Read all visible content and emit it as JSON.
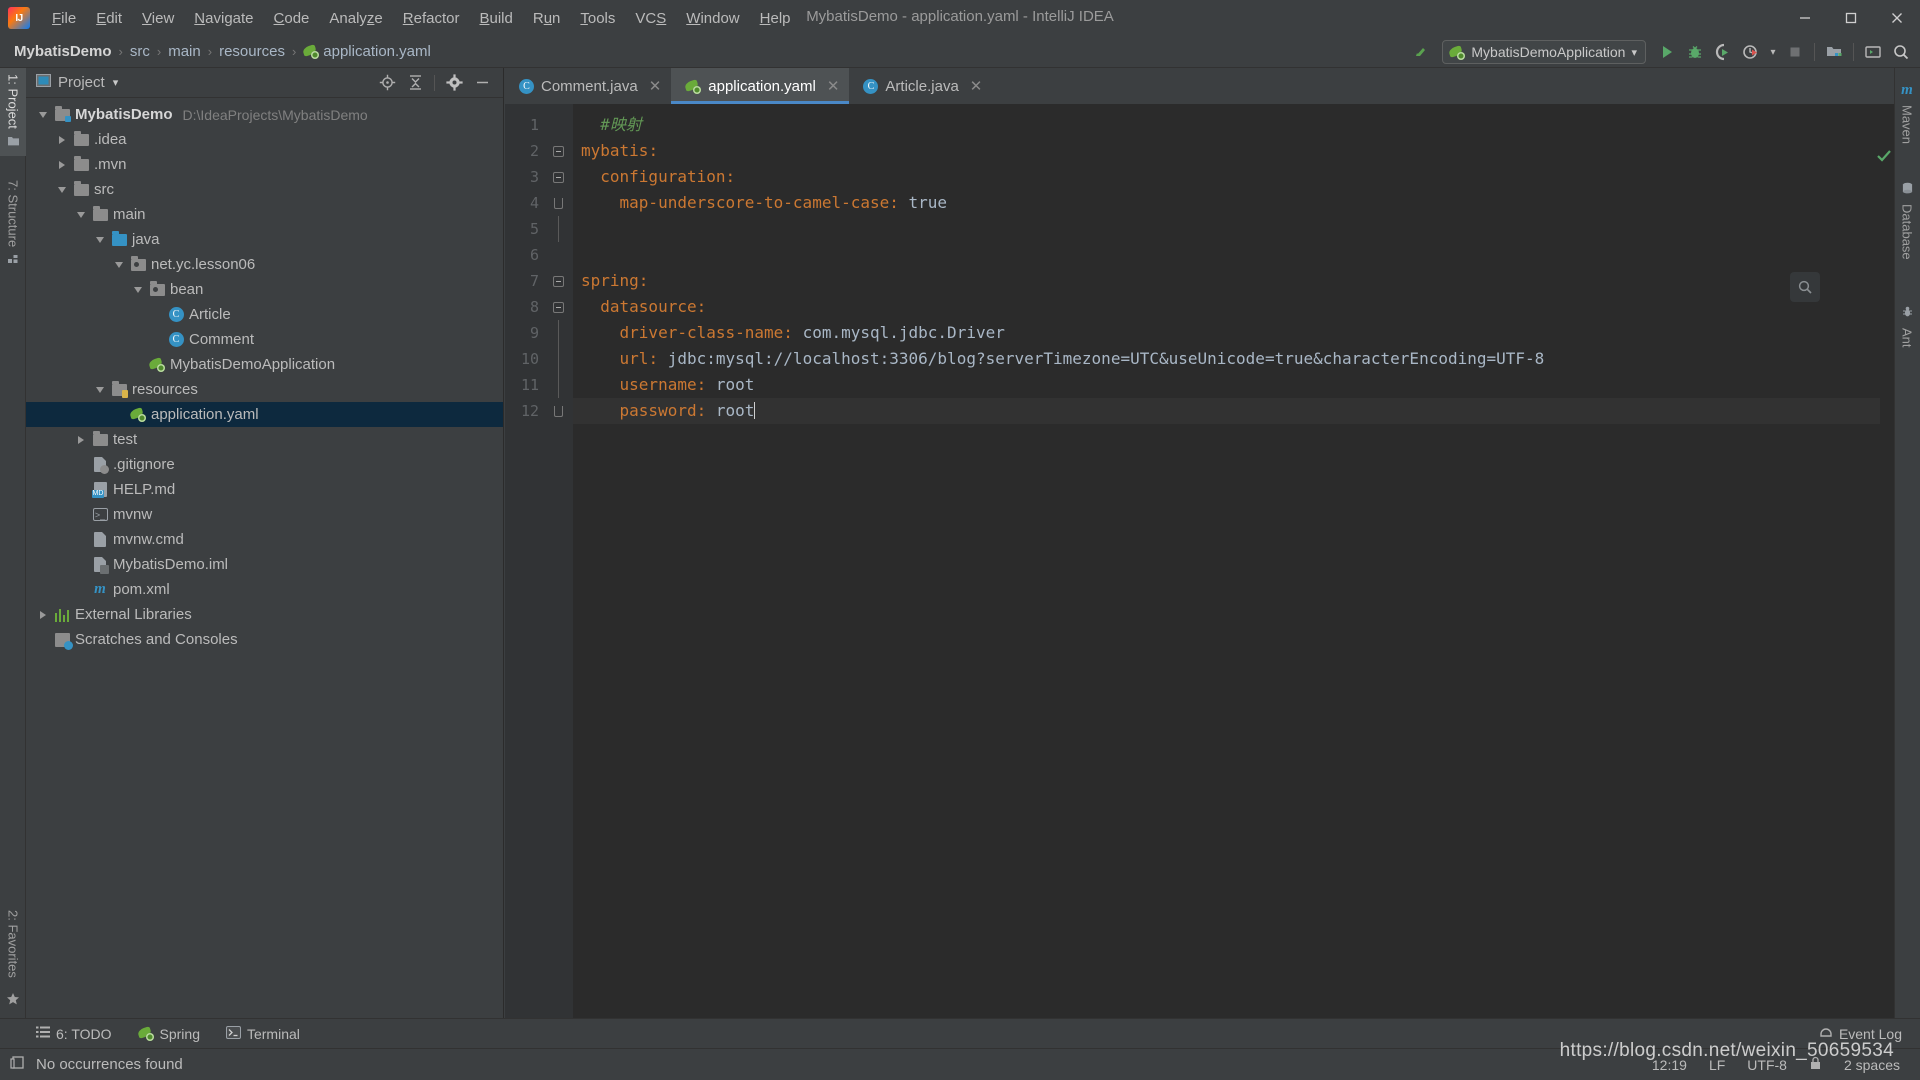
{
  "window": {
    "title": "MybatisDemo - application.yaml - IntelliJ IDEA",
    "minimize": "—",
    "maximize": "❐",
    "close": "✕"
  },
  "menu": {
    "items": [
      {
        "label": "File",
        "mnemonic": "F"
      },
      {
        "label": "Edit",
        "mnemonic": "E"
      },
      {
        "label": "View",
        "mnemonic": "V"
      },
      {
        "label": "Navigate",
        "mnemonic": "N"
      },
      {
        "label": "Code",
        "mnemonic": "C"
      },
      {
        "label": "Analyze",
        "mnemonic": "z"
      },
      {
        "label": "Refactor",
        "mnemonic": "R"
      },
      {
        "label": "Build",
        "mnemonic": "B"
      },
      {
        "label": "Run",
        "mnemonic": "u"
      },
      {
        "label": "Tools",
        "mnemonic": "T"
      },
      {
        "label": "VCS",
        "mnemonic": "S"
      },
      {
        "label": "Window",
        "mnemonic": "W"
      },
      {
        "label": "Help",
        "mnemonic": "H"
      }
    ]
  },
  "breadcrumb": {
    "items": [
      "MybatisDemo",
      "src",
      "main",
      "resources",
      "application.yaml"
    ],
    "separator": "›"
  },
  "toolbar": {
    "run_config": "MybatisDemoApplication",
    "run_config_dropdown": "▾",
    "buttons": [
      {
        "name": "run-button",
        "label": "Run"
      },
      {
        "name": "debug-button",
        "label": "Debug"
      },
      {
        "name": "run-coverage-button",
        "label": "Run with Coverage"
      },
      {
        "name": "profile-button",
        "label": "Profile"
      },
      {
        "name": "stop-button",
        "label": "Stop"
      },
      {
        "name": "project-structure-button",
        "label": "Project Structure"
      },
      {
        "name": "terminal-button",
        "label": "Terminal"
      },
      {
        "name": "search-everywhere-button",
        "label": "Search Everywhere"
      }
    ]
  },
  "left_stripe": {
    "items": [
      {
        "label": "1: Project",
        "mnemonic": "1",
        "active": true
      },
      {
        "label": "7: Structure",
        "mnemonic": "7",
        "active": false
      },
      {
        "label": "2: Favorites",
        "mnemonic": "2",
        "active": false
      }
    ]
  },
  "right_stripe": {
    "items": [
      {
        "label": "Maven",
        "icon": "m"
      },
      {
        "label": "Database",
        "icon": "db"
      },
      {
        "label": "Ant",
        "icon": "ant"
      }
    ]
  },
  "project_panel": {
    "title": "Project",
    "dropdown_caret": "▾",
    "actions": [
      {
        "name": "locate-file-icon",
        "label": "Select Opened File"
      },
      {
        "name": "collapse-all-icon",
        "label": "Collapse All"
      },
      {
        "name": "gear-icon",
        "label": "Settings"
      },
      {
        "name": "hide-icon",
        "label": "Hide"
      }
    ],
    "tree": [
      {
        "indent": 0,
        "arrow": "down",
        "icon": "folder-src",
        "label": "MybatisDemo",
        "bold": true,
        "sub": "D:\\IdeaProjects\\MybatisDemo",
        "selected": false
      },
      {
        "indent": 1,
        "arrow": "right",
        "icon": "folder",
        "label": ".idea",
        "bold": false,
        "sub": "",
        "selected": false
      },
      {
        "indent": 1,
        "arrow": "right",
        "icon": "folder",
        "label": ".mvn",
        "bold": false,
        "sub": "",
        "selected": false
      },
      {
        "indent": 1,
        "arrow": "down",
        "icon": "folder",
        "label": "src",
        "bold": false,
        "sub": "",
        "selected": false
      },
      {
        "indent": 2,
        "arrow": "down",
        "icon": "folder",
        "label": "main",
        "bold": false,
        "sub": "",
        "selected": false
      },
      {
        "indent": 3,
        "arrow": "down",
        "icon": "folder-blue",
        "label": "java",
        "bold": false,
        "sub": "",
        "selected": false
      },
      {
        "indent": 4,
        "arrow": "down",
        "icon": "package",
        "label": "net.yc.lesson06",
        "bold": false,
        "sub": "",
        "selected": false
      },
      {
        "indent": 5,
        "arrow": "down",
        "icon": "package",
        "label": "bean",
        "bold": false,
        "sub": "",
        "selected": false
      },
      {
        "indent": 6,
        "arrow": "none",
        "icon": "class",
        "label": "Article",
        "bold": false,
        "sub": "",
        "selected": false
      },
      {
        "indent": 6,
        "arrow": "none",
        "icon": "class",
        "label": "Comment",
        "bold": false,
        "sub": "",
        "selected": false
      },
      {
        "indent": 5,
        "arrow": "none",
        "icon": "spring-boot",
        "label": "MybatisDemoApplication",
        "bold": false,
        "sub": "",
        "selected": false
      },
      {
        "indent": 3,
        "arrow": "down",
        "icon": "folder-res",
        "label": "resources",
        "bold": false,
        "sub": "",
        "selected": false
      },
      {
        "indent": 4,
        "arrow": "none",
        "icon": "spring-yaml",
        "label": "application.yaml",
        "bold": false,
        "sub": "",
        "selected": true
      },
      {
        "indent": 2,
        "arrow": "right",
        "icon": "folder",
        "label": "test",
        "bold": false,
        "sub": "",
        "selected": false
      },
      {
        "indent": 2,
        "arrow": "none",
        "icon": "gitignore",
        "label": ".gitignore",
        "bold": false,
        "sub": "",
        "selected": false
      },
      {
        "indent": 2,
        "arrow": "none",
        "icon": "markdown",
        "label": "HELP.md",
        "bold": false,
        "sub": "",
        "selected": false
      },
      {
        "indent": 2,
        "arrow": "none",
        "icon": "shell",
        "label": "mvnw",
        "bold": false,
        "sub": "",
        "selected": false
      },
      {
        "indent": 2,
        "arrow": "none",
        "icon": "doc",
        "label": "mvnw.cmd",
        "bold": false,
        "sub": "",
        "selected": false
      },
      {
        "indent": 2,
        "arrow": "none",
        "icon": "iml",
        "label": "MybatisDemo.iml",
        "bold": false,
        "sub": "",
        "selected": false
      },
      {
        "indent": 2,
        "arrow": "none",
        "icon": "maven",
        "label": "pom.xml",
        "bold": false,
        "sub": "",
        "selected": false
      },
      {
        "indent": 0,
        "arrow": "right",
        "icon": "libraries",
        "label": "External Libraries",
        "bold": false,
        "sub": "",
        "selected": false
      },
      {
        "indent": 0,
        "arrow": "none",
        "icon": "scratches",
        "label": "Scratches and Consoles",
        "bold": false,
        "sub": "",
        "selected": false
      }
    ]
  },
  "editor": {
    "tabs": [
      {
        "label": "Comment.java",
        "icon": "java-class",
        "active": false,
        "close": "✕"
      },
      {
        "label": "application.yaml",
        "icon": "spring-yaml",
        "active": true,
        "close": "✕"
      },
      {
        "label": "Article.java",
        "icon": "java-class",
        "active": false,
        "close": "✕"
      }
    ],
    "lines": [
      {
        "no": "1",
        "fold": "none",
        "indent": 0,
        "tokens": [
          {
            "t": "#映射",
            "c": "comment"
          }
        ]
      },
      {
        "no": "2",
        "fold": "open",
        "indent": 0,
        "tokens": [
          {
            "t": "mybatis",
            "c": "key"
          },
          {
            "t": ":",
            "c": "colon"
          }
        ]
      },
      {
        "no": "3",
        "fold": "open",
        "indent": 1,
        "tokens": [
          {
            "t": "configuration",
            "c": "key"
          },
          {
            "t": ":",
            "c": "colon"
          }
        ]
      },
      {
        "no": "4",
        "fold": "end",
        "indent": 2,
        "tokens": [
          {
            "t": "map-underscore-to-camel-case",
            "c": "key"
          },
          {
            "t": ": ",
            "c": "colon"
          },
          {
            "t": "true",
            "c": "val"
          }
        ]
      },
      {
        "no": "5",
        "fold": "line",
        "indent": 0,
        "tokens": []
      },
      {
        "no": "6",
        "fold": "none",
        "indent": 0,
        "tokens": []
      },
      {
        "no": "7",
        "fold": "open",
        "indent": 0,
        "tokens": [
          {
            "t": "spring",
            "c": "key"
          },
          {
            "t": ":",
            "c": "colon"
          }
        ]
      },
      {
        "no": "8",
        "fold": "open",
        "indent": 1,
        "tokens": [
          {
            "t": "datasource",
            "c": "key"
          },
          {
            "t": ":",
            "c": "colon"
          }
        ]
      },
      {
        "no": "9",
        "fold": "line",
        "indent": 2,
        "tokens": [
          {
            "t": "driver-class-name",
            "c": "key"
          },
          {
            "t": ": ",
            "c": "colon"
          },
          {
            "t": "com.mysql.jdbc.Driver",
            "c": "val"
          }
        ]
      },
      {
        "no": "10",
        "fold": "line",
        "indent": 2,
        "tokens": [
          {
            "t": "url",
            "c": "key"
          },
          {
            "t": ": ",
            "c": "colon"
          },
          {
            "t": "jdbc:mysql://localhost:3306/blog?serverTimezone=UTC&useUnicode=true&characterEncoding=UTF-8",
            "c": "val"
          }
        ]
      },
      {
        "no": "11",
        "fold": "line",
        "indent": 2,
        "tokens": [
          {
            "t": "username",
            "c": "key"
          },
          {
            "t": ": ",
            "c": "colon"
          },
          {
            "t": "root",
            "c": "val"
          }
        ]
      },
      {
        "no": "12",
        "fold": "end",
        "indent": 2,
        "tokens": [
          {
            "t": "password",
            "c": "key"
          },
          {
            "t": ": ",
            "c": "colon"
          },
          {
            "t": "root",
            "c": "val"
          }
        ],
        "caret": true,
        "current": true
      }
    ]
  },
  "bottom_toolwindows": {
    "items": [
      {
        "label": "6: TODO",
        "mnemonic": "6",
        "icon": "todo-icon"
      },
      {
        "label": "Spring",
        "icon": "spring-icon"
      },
      {
        "label": "Terminal",
        "icon": "terminal-icon"
      }
    ],
    "event_log": "Event Log"
  },
  "statusbar": {
    "message": "No occurrences found",
    "caret_position": "12:19",
    "line_separator": "LF",
    "encoding": "UTF-8",
    "indent": "2 spaces"
  },
  "watermark": "https://blog.csdn.net/weixin_50659534",
  "colors": {
    "accent_blue": "#4a88c7",
    "selection_blue": "#0d293e",
    "editor_bg": "#2b2b2b",
    "panel_bg": "#3c3f41",
    "yaml_key": "#cc7832",
    "yaml_value": "#a9b7c6",
    "comment_green": "#629755"
  }
}
